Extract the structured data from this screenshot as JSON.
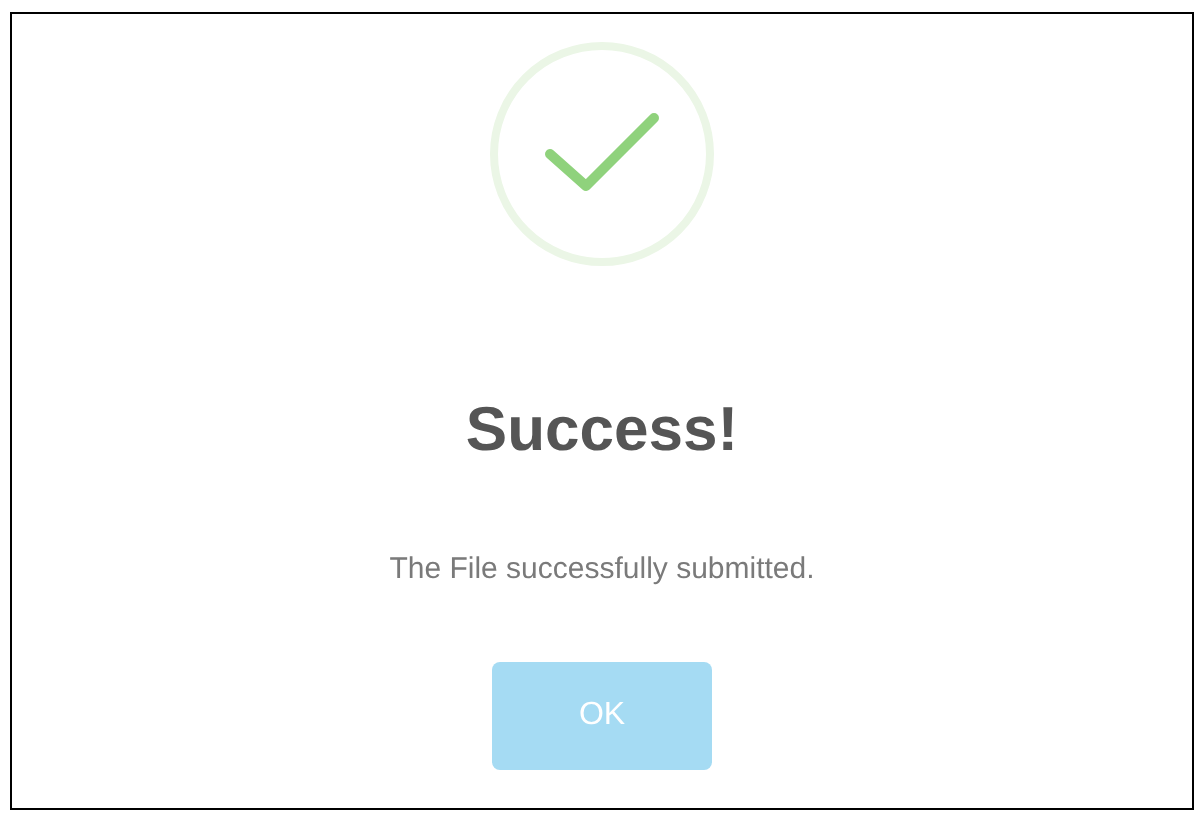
{
  "dialog": {
    "title": "Success!",
    "message": "The File successfully submitted.",
    "buttons": [
      "OK"
    ]
  }
}
